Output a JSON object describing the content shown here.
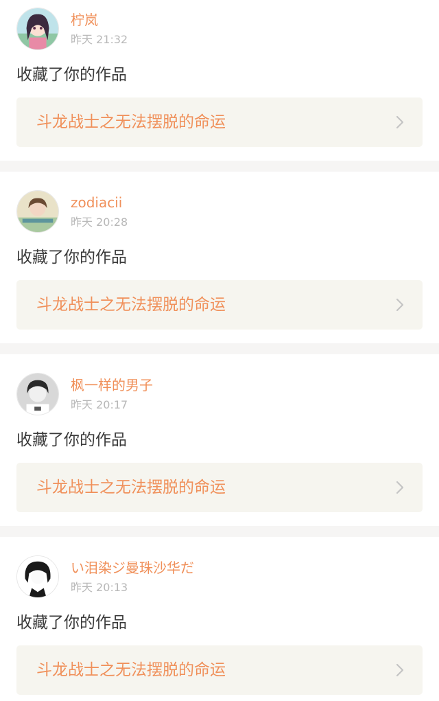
{
  "notifications": [
    {
      "username": "柠岚",
      "time": "昨天 21:32",
      "action": "收藏了你的作品",
      "work_title": "斗龙战士之无法摆脱的命运",
      "avatar_icon": "avatar-anime-girl",
      "chevron_icon": "chevron-right-icon"
    },
    {
      "username": "zodiacii",
      "time": "昨天 20:28",
      "action": "收藏了你的作品",
      "work_title": "斗龙战士之无法摆脱的命运",
      "avatar_icon": "avatar-photo-girl",
      "chevron_icon": "chevron-right-icon"
    },
    {
      "username": "枫一样的男子",
      "time": "昨天 20:17",
      "action": "收藏了你的作品",
      "work_title": "斗龙战士之无法摆脱的命运",
      "avatar_icon": "avatar-bw-boy",
      "chevron_icon": "chevron-right-icon"
    },
    {
      "username": "い泪染ジ曼珠沙华だ",
      "time": "昨天 20:13",
      "action": "收藏了你的作品",
      "work_title": "斗龙战士之无法摆脱的命运",
      "avatar_icon": "avatar-bw-anime",
      "chevron_icon": "chevron-right-icon"
    }
  ],
  "colors": {
    "accent": "#f0905a",
    "time_text": "#b8b8b8",
    "action_text": "#3a3a3a",
    "card_bg": "#f6f5ef",
    "separator": "#f6f5f4"
  }
}
